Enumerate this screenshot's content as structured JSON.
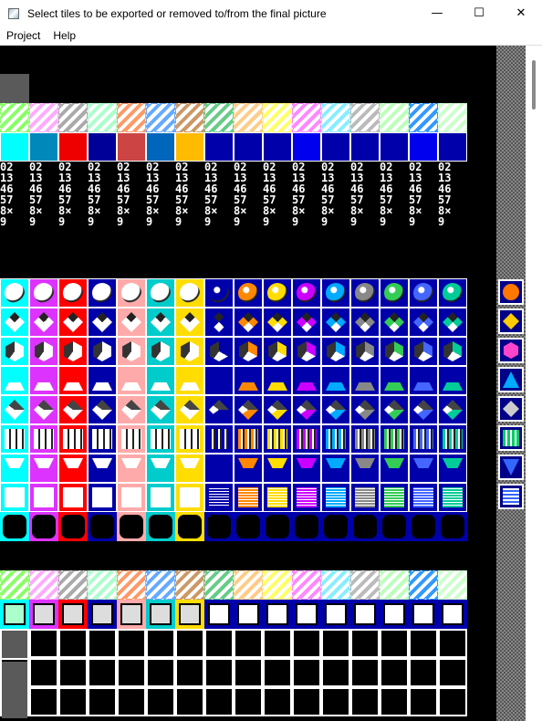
{
  "window": {
    "title": "Select tiles to be exported or removed to/from the final picture",
    "minimize_glyph": "—",
    "maximize_glyph": "☐",
    "close_glyph": "✕"
  },
  "menu": [
    "Project",
    "Help"
  ],
  "palette_colors": [
    "#00ffff",
    "#0088bb",
    "#ee0000",
    "#000099",
    "#cc4444",
    "#0066bb",
    "#ffbb00",
    "#0000aa",
    "#0000aa",
    "#0000aa",
    "#0000ee",
    "#0000aa",
    "#0000aa",
    "#0000aa",
    "#0000ee",
    "#0000aa"
  ],
  "gem_colors": [
    "#00ffff",
    "#dd33ff",
    "#ff0000",
    "#0000aa",
    "#ffaaaa",
    "#00cccc",
    "#ffdd00",
    "#0000aa",
    "#ff8800",
    "#ffdd00",
    "#cc00ff",
    "#00aaff",
    "#888888",
    "#33cc55",
    "#4466ff",
    "#00cc99"
  ],
  "stripe_colors": [
    "#88ff66",
    "#ffaaff",
    "#aaaaaa",
    "#aaffcc",
    "#ff9966",
    "#66aaff",
    "#cc9966",
    "#66cc88",
    "#ffcc88",
    "#ffff66",
    "#ff88ff",
    "#88eeff",
    "#bbbbbb",
    "#bbffbb",
    "#3399ff",
    "#ccffcc"
  ],
  "tiles_text": [
    "02",
    "13",
    "46",
    "57",
    "8×",
    "9"
  ],
  "side_colors": [
    "#ff7700",
    "#ffcc00",
    "#ff44cc",
    "#00aaff",
    "#cccccc",
    "#00cc66",
    "#3366ff",
    "#00aaff"
  ]
}
